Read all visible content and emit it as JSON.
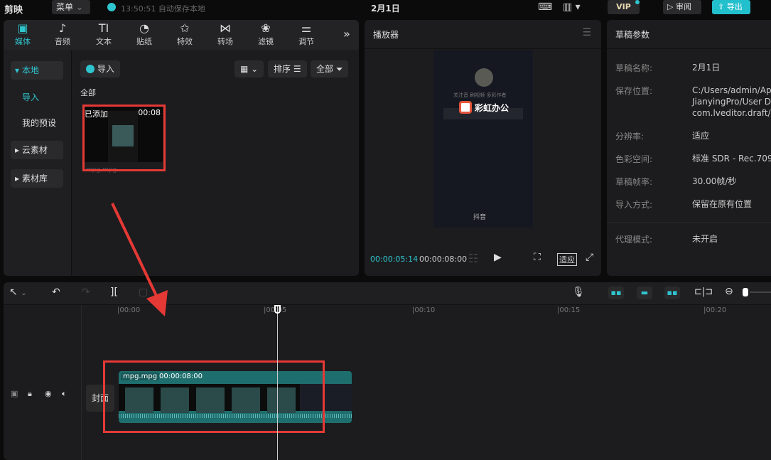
{
  "topbar": {
    "logo": "剪映",
    "menu": "菜单",
    "autosave": "13:50:51 自动保存本地",
    "title": "2月1日",
    "vip": "VIP",
    "review": "审阅",
    "export": "导出"
  },
  "media_tabs": [
    {
      "label": "媒体",
      "icon": "▣"
    },
    {
      "label": "音频",
      "icon": "♪"
    },
    {
      "label": "文本",
      "icon": "TI"
    },
    {
      "label": "贴纸",
      "icon": "◔"
    },
    {
      "label": "特效",
      "icon": "✩"
    },
    {
      "label": "转场",
      "icon": "⋈"
    },
    {
      "label": "滤镜",
      "icon": "❀"
    },
    {
      "label": "调节",
      "icon": "⚌"
    }
  ],
  "more": "»",
  "sidebar": [
    {
      "label": "▾ 本地"
    },
    {
      "label": "导入"
    },
    {
      "label": "我的预设"
    },
    {
      "label": "▸ 云素材"
    },
    {
      "label": "▸ 素材库"
    }
  ],
  "media": {
    "import": "导入",
    "sort": "排序",
    "filter": "全部",
    "section": "全部",
    "item": {
      "badge": "已添加",
      "duration": "00:08",
      "name": "mpg.mpg"
    }
  },
  "player": {
    "title": "播放器",
    "current": "00:00:05:14",
    "total": "00:00:08:00",
    "fit": "适应",
    "brand": "彩虹办公",
    "caption": "关注音 刷视频 多彩作者",
    "platform": "抖音"
  },
  "params": {
    "title": "草稿参数",
    "rows": [
      {
        "label": "草稿名称:",
        "value": "2月1日"
      },
      {
        "label": "保存位置:",
        "value": "C:/Users/admin/Ap\nJianyingPro/User D\ncom.lveditor.draft/2"
      },
      {
        "label": "分辨率:",
        "value": "适应"
      },
      {
        "label": "色彩空间:",
        "value": "标准 SDR - Rec.709"
      },
      {
        "label": "草稿帧率:",
        "value": "30.00帧/秒"
      },
      {
        "label": "导入方式:",
        "value": "保留在原有位置"
      },
      {
        "label": "代理模式:",
        "value": "未开启"
      }
    ]
  },
  "timeline": {
    "ticks": [
      "|00:00",
      "|00:05",
      "|00:10",
      "|00:15",
      "|00:20"
    ],
    "cover": "封面",
    "clip_name": "mpg.mpg",
    "clip_duration": "00:00:08:00"
  },
  "colors": {
    "accent": "#2fc5cf",
    "clip": "#1f6e6e",
    "annotation": "#e53935"
  }
}
